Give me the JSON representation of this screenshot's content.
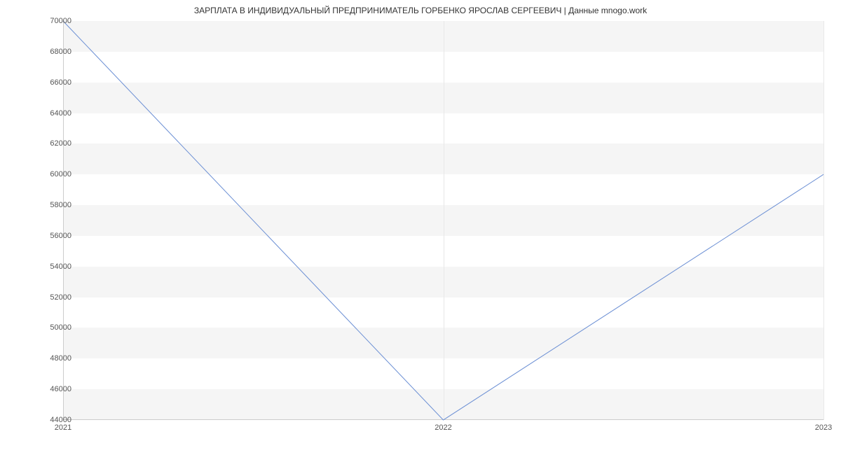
{
  "chart_data": {
    "type": "line",
    "title": "ЗАРПЛАТА В ИНДИВИДУАЛЬНЫЙ ПРЕДПРИНИМАТЕЛЬ ГОРБЕНКО ЯРОСЛАВ СЕРГЕЕВИЧ | Данные mnogo.work",
    "x": [
      "2021",
      "2022",
      "2023"
    ],
    "values": [
      70000,
      44000,
      60000
    ],
    "xlabel": "",
    "ylabel": "",
    "ylim": [
      44000,
      70000
    ],
    "y_ticks": [
      44000,
      46000,
      48000,
      50000,
      52000,
      54000,
      56000,
      58000,
      60000,
      62000,
      64000,
      66000,
      68000,
      70000
    ],
    "x_ticks": [
      "2021",
      "2022",
      "2023"
    ]
  }
}
